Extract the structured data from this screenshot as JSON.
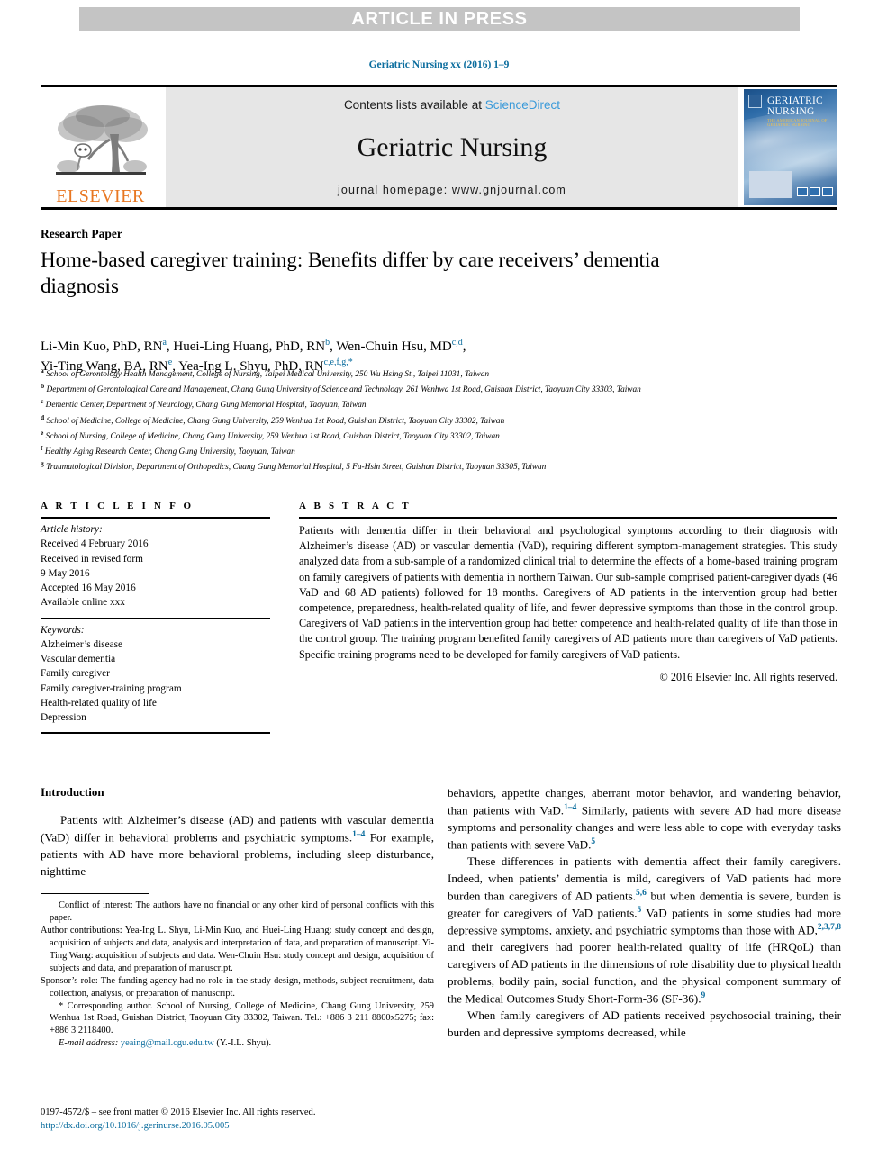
{
  "banner": {
    "text": "ARTICLE IN PRESS"
  },
  "runninghead": {
    "citation": "Geriatric Nursing xx (2016) 1–9"
  },
  "masthead": {
    "contents_prefix": "Contents lists available at ",
    "sciencedirect": "ScienceDirect",
    "journal_name": "Geriatric Nursing",
    "homepage": "journal homepage: www.gnjournal.com",
    "publisher_word": "ELSEVIER",
    "cover_title_line1": "GERIATRIC",
    "cover_title_line2": "NURSING",
    "cover_subtitle": "THE AMERICAN JOURNAL OF GERIATRIC NURSING"
  },
  "article": {
    "doctype": "Research Paper",
    "title": "Home-based caregiver training: Benefits differ by care receivers’ dementia diagnosis",
    "authors_line1": "Li-Min Kuo, PhD, RN",
    "authors": [
      {
        "name": "Li-Min Kuo, PhD, RN",
        "sup": "a"
      },
      {
        "name": "Huei-Ling Huang, PhD, RN",
        "sup": "b"
      },
      {
        "name": "Wen-Chuin Hsu, MD",
        "sup": "c,d"
      },
      {
        "name": "Yi-Ting Wang, BA, RN",
        "sup": "e"
      },
      {
        "name": "Yea-Ing L. Shyu, PhD, RN",
        "sup": "c,e,f,g,*"
      }
    ],
    "affiliations": [
      {
        "mark": "a",
        "text": "School of Gerontology Health Management, College of Nursing, Taipei Medical University, 250 Wu Hsing St., Taipei 11031, Taiwan"
      },
      {
        "mark": "b",
        "text": "Department of Gerontological Care and Management, Chang Gung University of Science and Technology, 261 Wenhwa 1st Road, Guishan District, Taoyuan City 33303, Taiwan"
      },
      {
        "mark": "c",
        "text": "Dementia Center, Department of Neurology, Chang Gung Memorial Hospital, Taoyuan, Taiwan"
      },
      {
        "mark": "d",
        "text": "School of Medicine, College of Medicine, Chang Gung University, 259 Wenhua 1st Road, Guishan District, Taoyuan City 33302, Taiwan"
      },
      {
        "mark": "e",
        "text": "School of Nursing, College of Medicine, Chang Gung University, 259 Wenhua 1st Road, Guishan District, Taoyuan City 33302, Taiwan"
      },
      {
        "mark": "f",
        "text": "Healthy Aging Research Center, Chang Gung University, Taoyuan, Taiwan"
      },
      {
        "mark": "g",
        "text": "Traumatological Division, Department of Orthopedics, Chang Gung Memorial Hospital, 5 Fu-Hsin Street, Guishan District, Taoyuan 33305, Taiwan"
      }
    ]
  },
  "article_info": {
    "label": "A R T I C L E    I N F O",
    "history_label": "Article history:",
    "history": [
      "Received 4 February 2016",
      "Received in revised form",
      "9 May 2016",
      "Accepted 16 May 2016",
      "Available online xxx"
    ],
    "keywords_label": "Keywords:",
    "keywords": [
      "Alzheimer’s disease",
      "Vascular dementia",
      "Family caregiver",
      "Family caregiver-training program",
      "Health-related quality of life",
      "Depression"
    ]
  },
  "abstract": {
    "label": "A B S T R A C T",
    "text": "Patients with dementia differ in their behavioral and psychological symptoms according to their diagnosis with Alzheimer’s disease (AD) or vascular dementia (VaD), requiring different symptom-management strategies. This study analyzed data from a sub-sample of a randomized clinical trial to determine the effects of a home-based training program on family caregivers of patients with dementia in northern Taiwan. Our sub-sample comprised patient-caregiver dyads (46 VaD and 68 AD patients) followed for 18 months. Caregivers of AD patients in the intervention group had better competence, preparedness, health-related quality of life, and fewer depressive symptoms than those in the control group. Caregivers of VaD patients in the intervention group had better competence and health-related quality of life than those in the control group. The training program benefited family caregivers of AD patients more than caregivers of VaD patients. Specific training programs need to be developed for family caregivers of VaD patients.",
    "copyright": "© 2016 Elsevier Inc. All rights reserved."
  },
  "body": {
    "intro_heading": "Introduction",
    "left_p1_a": "Patients with Alzheimer’s disease (AD) and patients with vascular dementia (VaD) differ in behavioral problems and psychiatric symptoms.",
    "left_p1_ref": "1–4",
    "left_p1_b": " For example, patients with AD have more behavioral problems, including sleep disturbance, nighttime",
    "right_p1_a": "behaviors, appetite changes, aberrant motor behavior, and wandering behavior, than patients with VaD.",
    "right_p1_ref1": "1–4",
    "right_p1_b": " Similarly, patients with severe AD had more disease symptoms and personality changes and were less able to cope with everyday tasks than patients with severe VaD.",
    "right_p1_ref2": "5",
    "right_p2_a": "These differences in patients with dementia affect their family caregivers. Indeed, when patients’ dementia is mild, caregivers of VaD patients had more burden than caregivers of AD patients.",
    "right_p2_ref1": "5,6",
    "right_p2_b": " but when dementia is severe, burden is greater for caregivers of VaD patients.",
    "right_p2_ref2": "5",
    "right_p2_c": " VaD patients in some studies had more depressive symptoms, anxiety, and psychiatric symptoms than those with AD,",
    "right_p2_ref3": "2,3,7,8",
    "right_p2_d": " and their caregivers had poorer health-related quality of life (HRQoL) than caregivers of AD patients in the dimensions of role disability due to physical health problems, bodily pain, social function, and the physical component summary of the Medical Outcomes Study Short-Form-36 (SF-36).",
    "right_p2_ref4": "9",
    "right_p3": "When family caregivers of AD patients received psychosocial training, their burden and depressive symptoms decreased, while"
  },
  "footnotes": {
    "conflict": "Conflict of interest: The authors have no financial or any other kind of personal conflicts with this paper.",
    "contributions": "Author contributions: Yea-Ing L. Shyu, Li-Min Kuo, and Huei-Ling Huang: study concept and design, acquisition of subjects and data, analysis and interpretation of data, and preparation of manuscript. Yi-Ting Wang: acquisition of subjects and data. Wen-Chuin Hsu: study concept and design, acquisition of subjects and data, and preparation of manuscript.",
    "sponsor": "Sponsor’s role: The funding agency had no role in the study design, methods, subject recruitment, data collection, analysis, or preparation of manuscript.",
    "corresponding": "* Corresponding author. School of Nursing, College of Medicine, Chang Gung University, 259 Wenhua 1st Road, Guishan District, Taoyuan City 33302, Taiwan. Tel.: +886 3 211 8800x5275; fax: +886 3 2118400.",
    "email_label": "E-mail address:",
    "email": "yeaing@mail.cgu.edu.tw",
    "email_owner": "(Y.-I.L. Shyu)."
  },
  "footer": {
    "issn": "0197-4572/$ – see front matter © 2016 Elsevier Inc. All rights reserved.",
    "doi": "http://dx.doi.org/10.1016/j.gerinurse.2016.05.005"
  }
}
